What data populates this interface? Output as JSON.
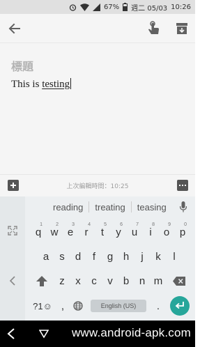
{
  "status_bar": {
    "battery": "67%",
    "date": "週二 05/03",
    "time": "10:26"
  },
  "toolbar": {
    "back_icon": "arrow-left-icon",
    "touch_icon": "touch-gesture-icon",
    "archive_icon": "archive-icon"
  },
  "note": {
    "title_placeholder": "標題",
    "body_prefix": "This is ",
    "body_word": "testing"
  },
  "note_bar": {
    "last_edited": "上次編輯時間：10:25"
  },
  "keyboard": {
    "suggestions": [
      "reading",
      "treating",
      "teasing"
    ],
    "row1": [
      {
        "key": "q",
        "hint": "1"
      },
      {
        "key": "w",
        "hint": "2"
      },
      {
        "key": "e",
        "hint": "3"
      },
      {
        "key": "r",
        "hint": "4"
      },
      {
        "key": "t",
        "hint": "5"
      },
      {
        "key": "y",
        "hint": "6"
      },
      {
        "key": "u",
        "hint": "7"
      },
      {
        "key": "i",
        "hint": "8"
      },
      {
        "key": "o",
        "hint": "9"
      },
      {
        "key": "p",
        "hint": "0"
      }
    ],
    "row2": [
      "a",
      "s",
      "d",
      "f",
      "g",
      "h",
      "j",
      "k",
      "l"
    ],
    "row3": [
      "z",
      "x",
      "c",
      "v",
      "b",
      "n",
      "m"
    ],
    "symbols_key": "?1☺",
    "comma_key": ",",
    "space_label": "English (US)",
    "period_key": "."
  },
  "nav_bar": {
    "watermark": "www.android-apk.com"
  }
}
